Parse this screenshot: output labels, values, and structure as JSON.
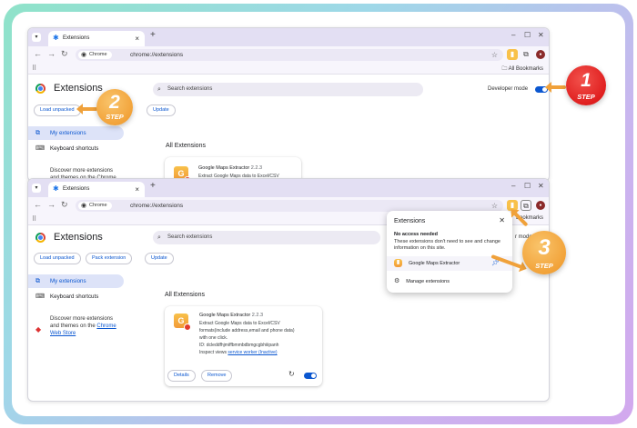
{
  "colors": {
    "accent": "#0b57d0",
    "step_orange": "#f2a33a",
    "step_red": "#e01f1f",
    "tab_strip": "#e3dff3"
  },
  "tab": {
    "title": "Extensions"
  },
  "omnibox": {
    "chip": "Chrome",
    "url": "chrome://extensions"
  },
  "bookmarks": {
    "label": "All Bookmarks",
    "label_cut": "Bookmarks"
  },
  "page": {
    "title": "Extensions",
    "search_placeholder": "Search extensions",
    "dev_mode": "Developer mode",
    "dev_mode_cut": "r mode",
    "buttons": {
      "load_unpacked": "Load unpacked",
      "pack": "Pack extension",
      "update": "Update"
    },
    "sidebar": {
      "my_extensions": "My extensions",
      "shortcuts": "Keyboard shortcuts",
      "store_line1": "Discover more extensions",
      "store_line2": "and themes on the",
      "store_link": "Chrome",
      "store_link2": "Web Store",
      "store_line2_top": "and themes on the Chrome"
    },
    "all_title": "All Extensions"
  },
  "extension": {
    "name": "Google Maps Extractor",
    "version": "2.2.3",
    "desc1": "Extract Google Maps data to Excel/CSV",
    "desc2": "formats(include address,email and phone data)",
    "desc3": "with one click.",
    "id": "ID: dcleddfhjmiffbmmbdbmgcgbhiiipanh",
    "inspect": "Inspect views",
    "inspect_link": "service worker (Inactive)",
    "details": "Details",
    "remove": "Remove",
    "short_desc": "Extract Google Maps data to Excel/CSV"
  },
  "popup": {
    "title": "Extensions",
    "no_access": "No access needed",
    "no_access_desc": "These extensions don't need to see and change information on this site.",
    "ext_name": "Google Maps Extractor",
    "manage": "Manage extensions"
  },
  "steps": [
    {
      "num": "1",
      "label": "STEP"
    },
    {
      "num": "2",
      "label": "STEP"
    },
    {
      "num": "3",
      "label": "STEP"
    }
  ],
  "icons": [
    "chrome-logo-icon",
    "search-icon",
    "puzzle-icon",
    "keyboard-icon",
    "store-icon",
    "reload-icon",
    "pin-icon",
    "gear-icon",
    "close-icon",
    "star-icon",
    "apps-icon",
    "folder-icon"
  ]
}
